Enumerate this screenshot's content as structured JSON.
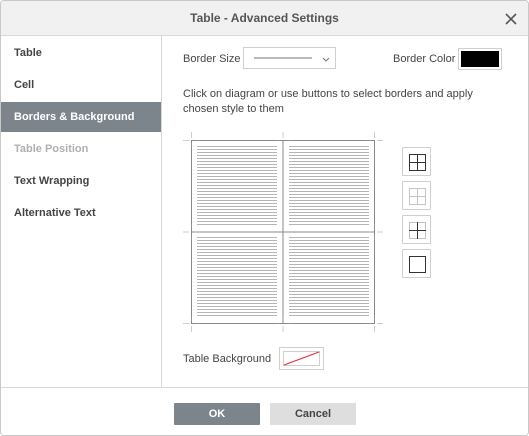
{
  "dialog": {
    "title": "Table - Advanced Settings"
  },
  "sidebar": {
    "items": [
      {
        "label": "Table",
        "state": "normal"
      },
      {
        "label": "Cell",
        "state": "normal"
      },
      {
        "label": "Borders & Background",
        "state": "active"
      },
      {
        "label": "Table Position",
        "state": "disabled"
      },
      {
        "label": "Text Wrapping",
        "state": "normal"
      },
      {
        "label": "Alternative Text",
        "state": "normal"
      }
    ]
  },
  "borders": {
    "size_label": "Border Size",
    "color_label": "Border Color",
    "color_value": "#000000",
    "instructions": "Click on diagram or use buttons to select borders and apply chosen style to them",
    "preset_buttons": [
      {
        "icon": "all-borders-icon"
      },
      {
        "icon": "inner-borders-icon"
      },
      {
        "icon": "inner-lines-icon"
      },
      {
        "icon": "outer-border-icon"
      }
    ]
  },
  "background": {
    "label": "Table Background",
    "value": "none"
  },
  "footer": {
    "ok_label": "OK",
    "cancel_label": "Cancel"
  },
  "colors": {
    "accent": "#7d858c",
    "no_fill_line": "#e0303a"
  }
}
